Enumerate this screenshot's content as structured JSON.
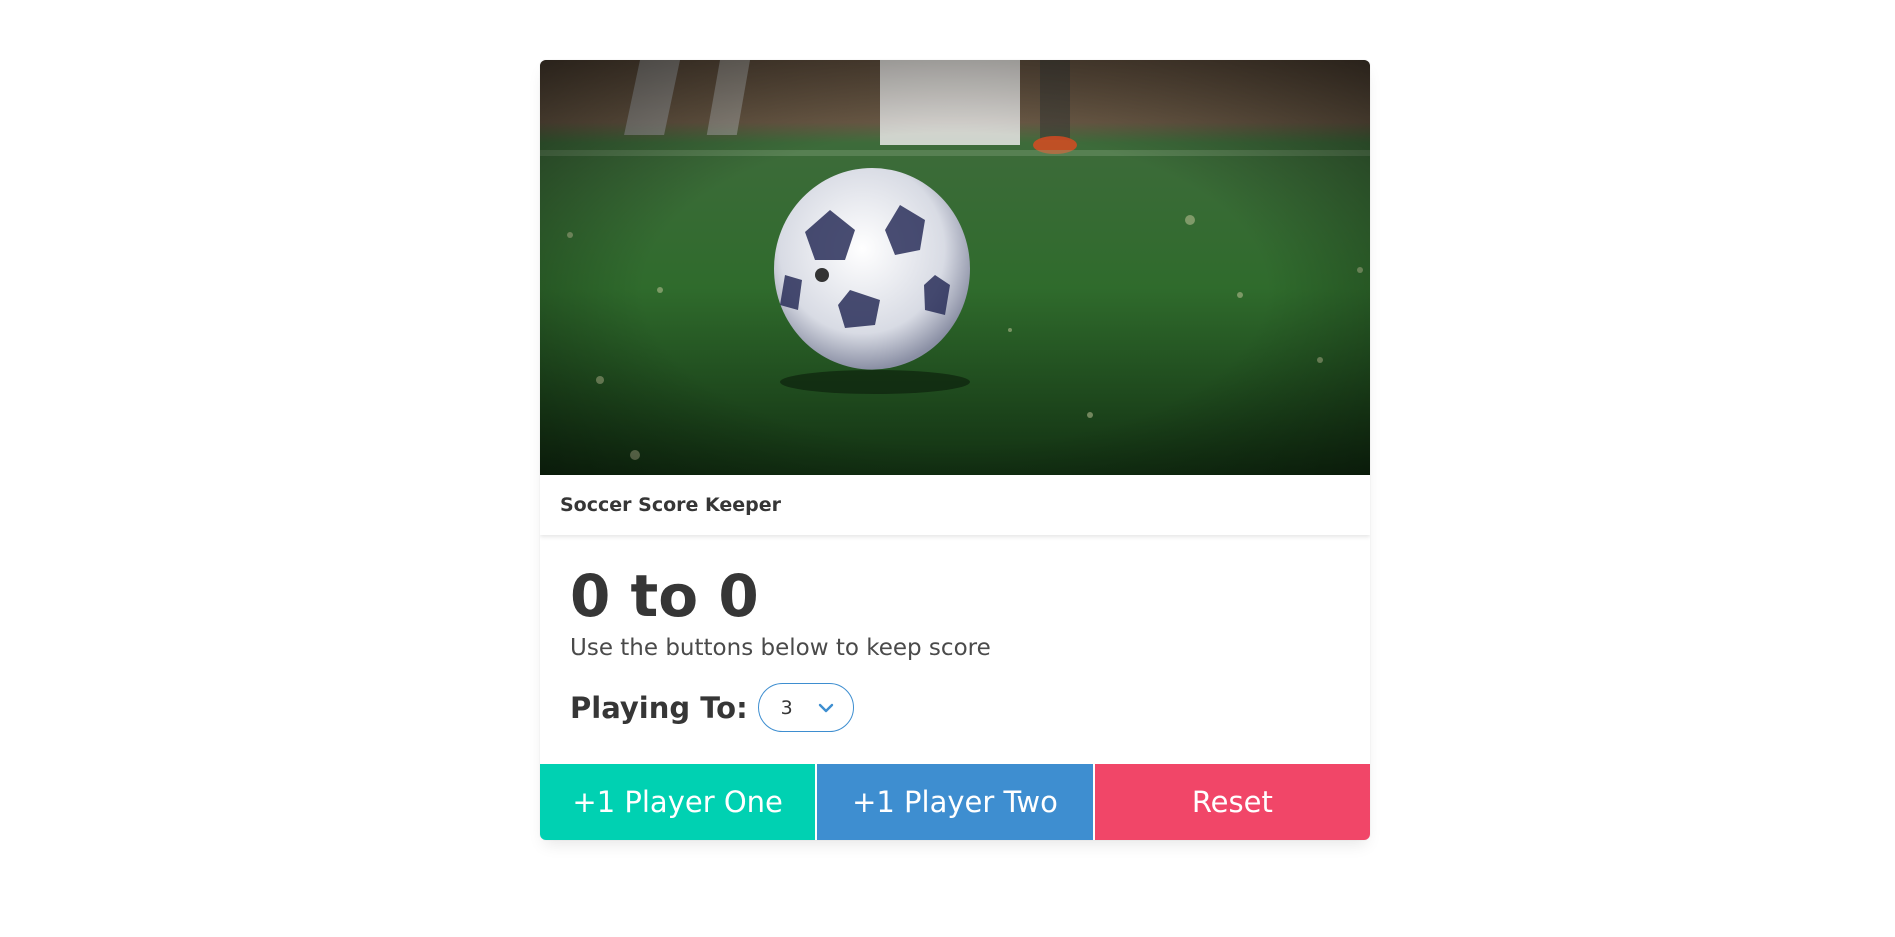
{
  "card": {
    "title": "Soccer Score Keeper",
    "score_text": "0 to 0",
    "subtitle": "Use the buttons below to keep score",
    "playing_to_label": "Playing To:",
    "playing_to_value": "3"
  },
  "buttons": {
    "player_one": "+1 Player One",
    "player_two": "+1 Player Two",
    "reset": "Reset"
  },
  "colors": {
    "player_one": "#00d1b2",
    "player_two": "#3e8ed0",
    "reset": "#f14668"
  },
  "icons": {
    "select_arrow": "chevron-down-icon"
  }
}
